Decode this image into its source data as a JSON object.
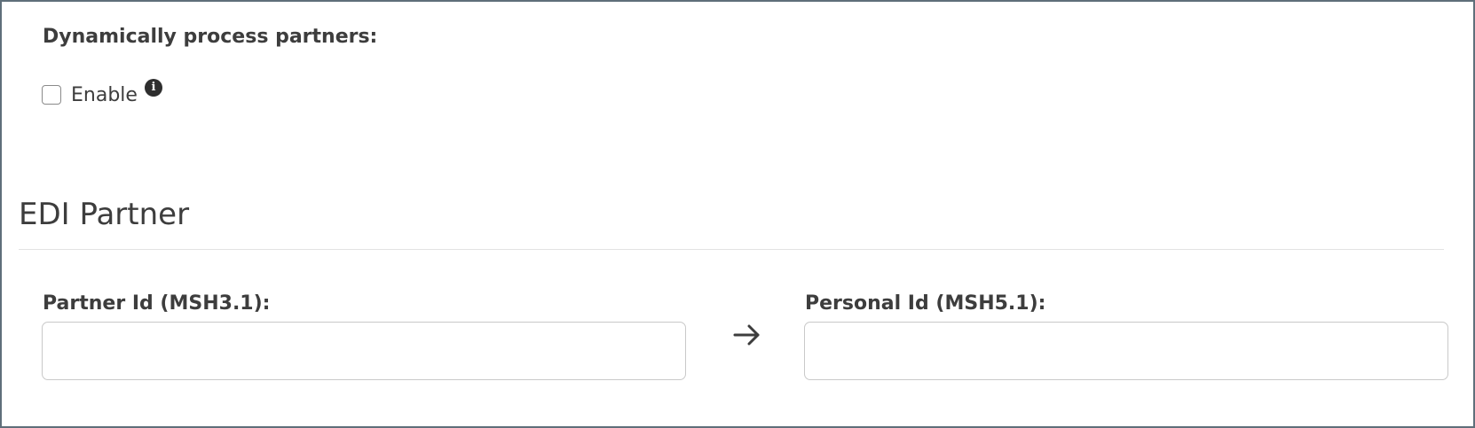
{
  "dynamic_partners": {
    "heading": "Dynamically process partners:",
    "enable_label": "Enable",
    "enabled": false,
    "info_icon": "info-circle-icon"
  },
  "edi_partner": {
    "title": "EDI Partner",
    "partner_id_label": "Partner Id (MSH3.1):",
    "partner_id_value": "",
    "arrow_icon": "arrow-right-icon",
    "personal_id_label": "Personal Id (MSH5.1):",
    "personal_id_value": ""
  }
}
